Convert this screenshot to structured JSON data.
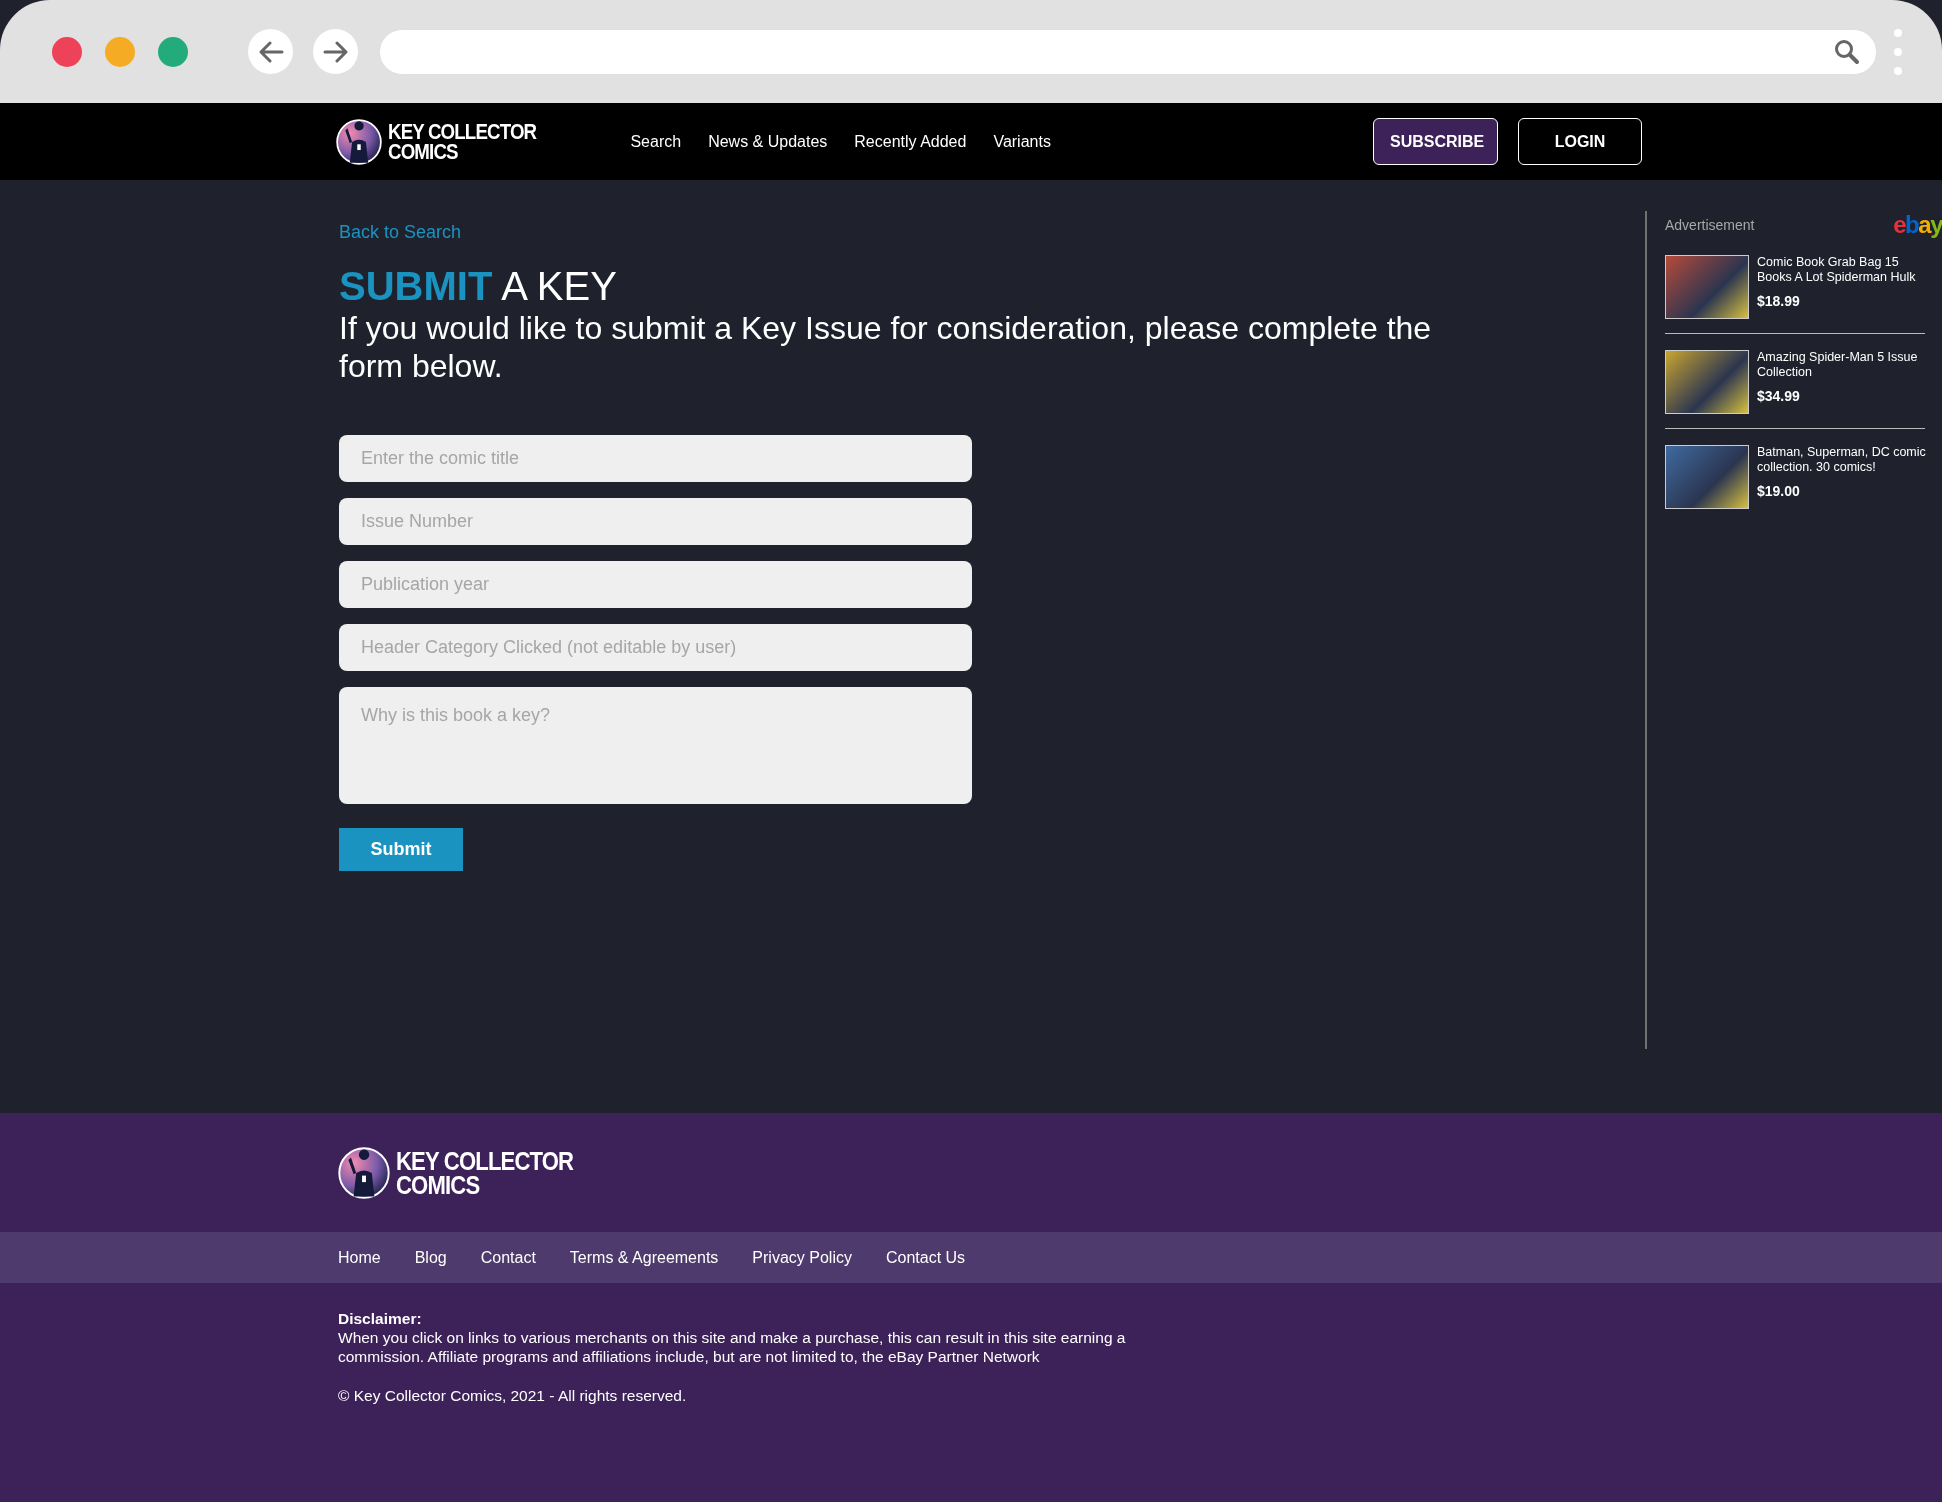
{
  "nav": {
    "logo": {
      "line_1": "KEY COLLECTOR",
      "line_2": "COMICS"
    },
    "links": [
      "Search",
      "News & Updates",
      "Recently Added",
      "Variants"
    ],
    "buttons": [
      {
        "label": "SUBSCRIBE",
        "kind": "primary"
      },
      {
        "label": "LOGIN",
        "kind": "outline"
      }
    ]
  },
  "main": {
    "back_link": "Back to Search",
    "title": "**SUBMIT** A KEY",
    "subtitle": "If you would like to submit a Key Issue for consideration, please complete the form below.",
    "fields": [
      {
        "kind": "input",
        "placeholder": "Enter the comic title"
      },
      {
        "kind": "input",
        "placeholder": "Issue Number"
      },
      {
        "kind": "input",
        "placeholder": "Publication year"
      },
      {
        "kind": "input",
        "placeholder": "Header Category Clicked (not editable by user)"
      },
      {
        "kind": "textarea",
        "placeholder": "Why is this book a key?"
      }
    ],
    "submit": "Submit"
  },
  "sidebar": {
    "label": "Advertisement",
    "brand": "ebay",
    "ads": [
      {
        "title": "Comic Book Grab Bag  15 Books A Lot Spiderman Hulk",
        "price": "$18.99"
      },
      {
        "title": "Amazing Spider-Man 5 Issue Collection",
        "price": "$34.99"
      },
      {
        "title": "Batman, Superman, DC comic collection. 30 comics!",
        "price": "$19.00"
      }
    ]
  },
  "footer": {
    "logo": {
      "line_1": "KEY COLLECTOR",
      "line_2": "COMICS"
    },
    "links": [
      "Home",
      "Blog",
      "Contact",
      "Terms & Agreements",
      "Privacy Policy",
      "Contact Us"
    ],
    "disclaimer_heading": "Disclaimer:",
    "disclaimer": "When you click on links to various merchants on this site and make a purchase, this can result in this site earning a commission. Affiliate programs and affiliations include, but are not limited to, the eBay Partner Network",
    "copyright": "© Key Collector Comics, 2021 - All rights reserved."
  }
}
